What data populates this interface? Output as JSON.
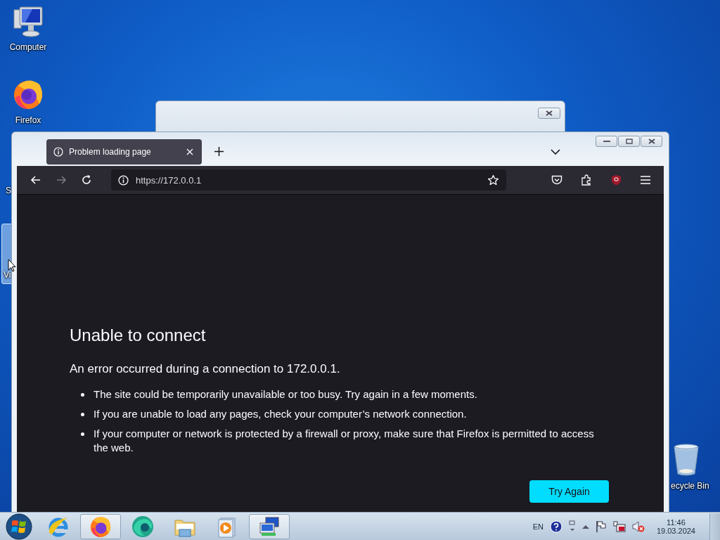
{
  "desktop_icons": [
    {
      "kind": "computer",
      "label": "Computer"
    },
    {
      "kind": "firefox",
      "label": "Firefox"
    },
    {
      "kind": "hidden",
      "label": "S"
    },
    {
      "kind": "selected-hidden",
      "label": "Vi"
    },
    {
      "kind": "recycle",
      "label": "ecycle Bin"
    }
  ],
  "browser": {
    "tabs": [
      {
        "title": "Problem loading page",
        "selected": true
      }
    ],
    "nav_buttons": [
      {
        "kind": "back",
        "disabled": false
      },
      {
        "kind": "forward",
        "disabled": true
      },
      {
        "kind": "reload",
        "disabled": false
      }
    ],
    "url": "https://172.0.0.1",
    "error": {
      "heading": "Unable to connect",
      "description": "An error occurred during a connection to 172.0.0.1.",
      "bullets": [
        "The site could be temporarily unavailable or too busy. Try again in a few moments.",
        "If you are unable to load any pages, check your computer’s network connection.",
        "If your computer or network is protected by a firewall or proxy, make sure that Firefox is permitted to access the web."
      ],
      "button": "Try Again"
    }
  },
  "taskbar": {
    "apps": [
      {
        "kind": "ie",
        "active": false
      },
      {
        "kind": "firefox",
        "active": true
      },
      {
        "kind": "edge",
        "active": false
      },
      {
        "kind": "explorer",
        "active": false
      },
      {
        "kind": "media",
        "active": false
      },
      {
        "kind": "network",
        "active": true
      }
    ],
    "language": "EN",
    "time": "11:46",
    "date": "19.03.2024"
  }
}
